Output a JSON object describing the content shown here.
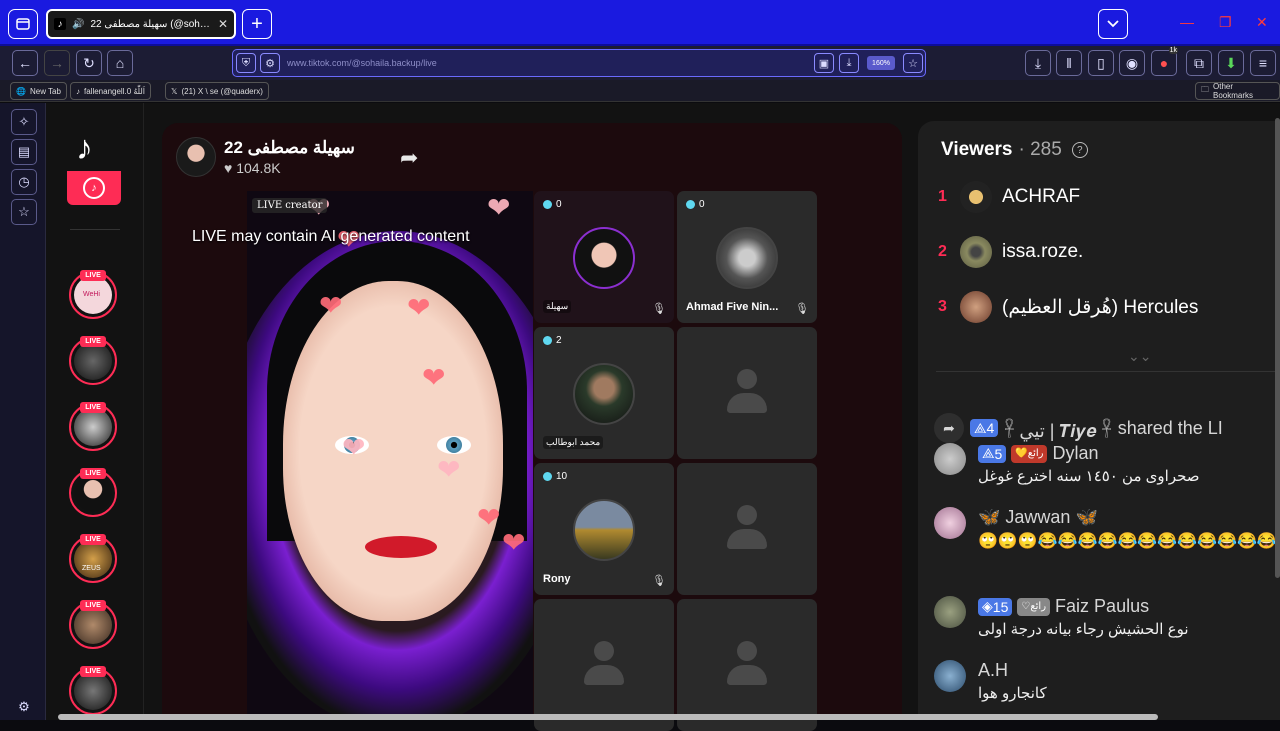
{
  "browser": {
    "tab_title": "سهيلة مصطفى 22 (@sohaila.backup...",
    "url": "www.tiktok.com/@sohaila.backup/live",
    "zoom": "160%",
    "bookmarks": [
      "New Tab",
      "fallenangell.0 ‏اَللّٰهُ",
      "(21) X \\ se (@quaderx)"
    ],
    "other_bookmarks": "Other Bookmarks",
    "ext_badge": "1k"
  },
  "host": {
    "name": "سهيلة مصطفى 22",
    "likes": "104.8K"
  },
  "video": {
    "live_creator_label": "LIVE creator",
    "ai_notice": "LIVE may contain AI generated content"
  },
  "guests": [
    {
      "count": "0",
      "name": "سهيلة"
    },
    {
      "count": "0",
      "name": "Ahmad Five Nin..."
    },
    {
      "count": "2",
      "name": "محمد ابوطالب"
    },
    {
      "count": "10",
      "name": "Rony"
    }
  ],
  "sidebar_live_label": "LIVE",
  "sidebar_live_names": [
    "WeHi",
    "ZEUS"
  ],
  "viewers": {
    "label": "Viewers",
    "count": "· 285",
    "ranking": [
      {
        "rank": "1",
        "name": "ACHRAF"
      },
      {
        "rank": "2",
        "name": "issa.roze."
      },
      {
        "rank": "3",
        "name": "(هُرقل العظيم) Hercules"
      }
    ]
  },
  "chat": {
    "shared": {
      "level": "4",
      "user": "𓋹 تيي | 𝑻𝒊𝒚𝒆 𓋹",
      "text": "shared the LI"
    },
    "messages": [
      {
        "level": "5",
        "badge": "رائع",
        "user": "Dylan",
        "text": "صحراوى من ١٤٥٠ سنه اخترع غوغل"
      },
      {
        "level": "",
        "badge": "",
        "user": "🦋 Jawwan 🦋",
        "text": "🙄🙄🙄😂😂😂😂😂😂😂😂😂😂😂😂"
      },
      {
        "level": "15",
        "badge": "رائع",
        "user": "Faiz Paulus",
        "text": "نوع الحشيش رجاء بيانه درجة اولى"
      },
      {
        "level": "",
        "badge": "",
        "user": "A.H",
        "text": "كانجارو هوا"
      }
    ]
  },
  "colors": {
    "tiktok_red": "#fe2c55",
    "browser_blue": "#1a1ae0",
    "level_blue": "#4a78e6"
  }
}
